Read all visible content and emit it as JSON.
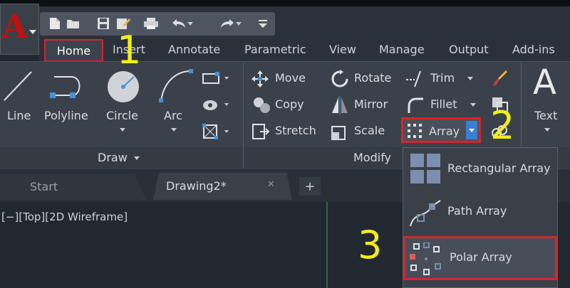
{
  "app": {
    "logo_letter": "A"
  },
  "tabs": [
    {
      "label": "Home",
      "active": true
    },
    {
      "label": "Insert"
    },
    {
      "label": "Annotate"
    },
    {
      "label": "Parametric"
    },
    {
      "label": "View"
    },
    {
      "label": "Manage"
    },
    {
      "label": "Output"
    },
    {
      "label": "Add-ins"
    }
  ],
  "draw_panel": {
    "title": "Draw",
    "tools": [
      "Line",
      "Polyline",
      "Circle",
      "Arc"
    ]
  },
  "modify_panel": {
    "title": "Modify",
    "move": "Move",
    "rotate": "Rotate",
    "trim": "Trim",
    "copy": "Copy",
    "mirror": "Mirror",
    "fillet": "Fillet",
    "stretch": "Stretch",
    "scale": "Scale",
    "array": "Array"
  },
  "annotation_panel": {
    "text": "Text",
    "glyph": "A"
  },
  "file_tabs": [
    {
      "label": "Start"
    },
    {
      "label": "Drawing2*",
      "active": true
    },
    {
      "label": "+"
    }
  ],
  "file_tab_close": "✕",
  "viewport_label": "[−][Top][2D Wireframe]",
  "array_menu": [
    {
      "label": "Rectangular Array"
    },
    {
      "label": "Path Array"
    },
    {
      "label": "Polar Array",
      "highlighted": true
    }
  ],
  "step_numbers": [
    "1",
    "2",
    "3"
  ],
  "colors": {
    "highlight": "#d8242b",
    "step_number": "#f2ef12",
    "accent_blue": "#4a90d8"
  }
}
